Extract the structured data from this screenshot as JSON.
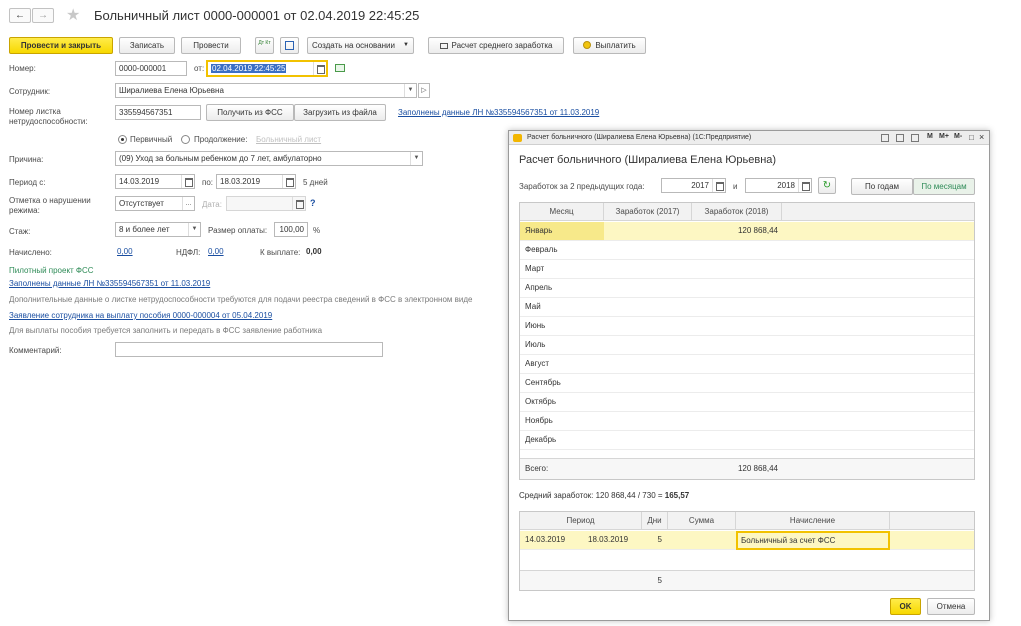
{
  "window": {
    "title": "Больничный лист 0000-000001 от 02.04.2019 22:45:25"
  },
  "toolbar": {
    "post_close": "Провести и закрыть",
    "write": "Записать",
    "post": "Провести",
    "create_based": "Создать на основании",
    "avg_earnings": "Расчет среднего заработка",
    "pay": "Выплатить",
    "dtkt_icon_text": "Дт Кт"
  },
  "form": {
    "number_label": "Номер:",
    "number_value": "0000-000001",
    "date_label": "от:",
    "date_value": "02.04.2019 22:45:25",
    "employee_label": "Сотрудник:",
    "employee_value": "Ширалиева Елена Юрьевна",
    "sheet_number_label": "Номер листка нетрудоспособности:",
    "sheet_number_value": "335594567351",
    "get_from_fss": "Получить из ФСС",
    "load_from_file": "Загрузить из файла",
    "filled_link": "Заполнены данные ЛН №335594567351 от 11.03.2019",
    "primary_label": "Первичный",
    "continuation_label": "Продолжение:",
    "continuation_placeholder": "Больничный лист",
    "reason_label": "Причина:",
    "reason_value": "(09) Уход за больным ребенком до 7 лет, амбулаторно",
    "period_label": "Период с:",
    "period_from": "14.03.2019",
    "period_to_label": "по:",
    "period_to": "18.03.2019",
    "period_days": "5 дней",
    "violation_label": "Отметка о нарушении режима:",
    "violation_value": "Отсутствует",
    "violation_date_label": "Дата:",
    "help_mark": "?",
    "experience_label": "Стаж:",
    "experience_value": "8 и более лет",
    "payment_size_label": "Размер оплаты:",
    "payment_size_value": "100,00",
    "percent_sign": "%",
    "accrued_label": "Начислено:",
    "accrued_value": "0,00",
    "ndfl_label": "НДФЛ:",
    "ndfl_value": "0,00",
    "to_pay_label": "К выплате:",
    "to_pay_value": "0,00",
    "pilot_title": "Пилотный проект ФСС",
    "pilot_link": "Заполнены данные ЛН №335594567351 от 11.03.2019",
    "pilot_note": "Дополнительные данные о листке нетрудоспособности требуются для подачи реестра сведений в ФСС в электронном виде",
    "application_link": "Заявление сотрудника на выплату пособия 0000-000004 от 05.04.2019",
    "application_note": "Для выплаты пособия требуется заполнить и передать в ФСС заявление работника",
    "comment_label": "Комментарий:",
    "comment_value": ""
  },
  "modal": {
    "window_title": "Расчет больничного (Ширалиева Елена Юрьевна) (1С:Предприятие)",
    "titlebar_buttons": [
      "M",
      "M+",
      "M-"
    ],
    "heading": "Расчет больничного (Ширалиева Елена Юрьевна)",
    "earnings_label": "Заработок за 2 предыдущих года:",
    "year1": "2017",
    "and_label": "и",
    "year2": "2018",
    "by_years": "По годам",
    "by_months": "По месяцам",
    "months_table": {
      "headers": [
        "Месяц",
        "Заработок (2017)",
        "Заработок (2018)"
      ],
      "rows": [
        {
          "month": "Январь",
          "y2017": "",
          "y2018": "120 868,44"
        },
        {
          "month": "Февраль",
          "y2017": "",
          "y2018": ""
        },
        {
          "month": "Март",
          "y2017": "",
          "y2018": ""
        },
        {
          "month": "Апрель",
          "y2017": "",
          "y2018": ""
        },
        {
          "month": "Май",
          "y2017": "",
          "y2018": ""
        },
        {
          "month": "Июнь",
          "y2017": "",
          "y2018": ""
        },
        {
          "month": "Июль",
          "y2017": "",
          "y2018": ""
        },
        {
          "month": "Август",
          "y2017": "",
          "y2018": ""
        },
        {
          "month": "Сентябрь",
          "y2017": "",
          "y2018": ""
        },
        {
          "month": "Октябрь",
          "y2017": "",
          "y2018": ""
        },
        {
          "month": "Ноябрь",
          "y2017": "",
          "y2018": ""
        },
        {
          "month": "Декабрь",
          "y2017": "",
          "y2018": ""
        }
      ],
      "total_label": "Всего:",
      "total_2017": "",
      "total_2018": "120 868,44"
    },
    "avg_prefix": "Средний заработок: 120 868,44 / 730 =",
    "avg_value": "165,57",
    "accrual_table": {
      "headers": [
        "Период",
        "Дни",
        "Сумма",
        "Начисление"
      ],
      "rows": [
        {
          "from": "14.03.2019",
          "to": "18.03.2019",
          "days": "5",
          "sum": "",
          "accrual": "Больничный за счет ФСС"
        }
      ],
      "total_days": "5"
    },
    "ok": "OK",
    "cancel": "Отмена"
  },
  "colors": {
    "accent_yellow": "#f7d800",
    "row_highlight": "#fdf7c3",
    "link": "#1a4ea1",
    "green_text": "#2e8b57"
  }
}
